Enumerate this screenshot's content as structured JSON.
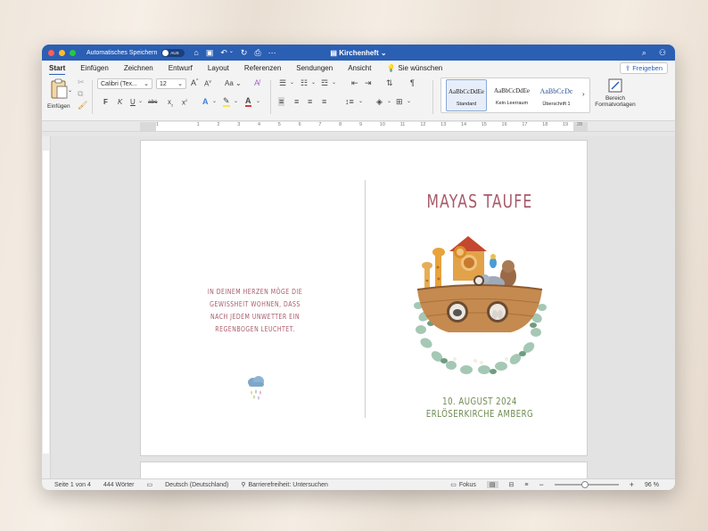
{
  "titlebar": {
    "autosave_label": "Automatisches Speichern",
    "autosave_state": "AUS",
    "document_title": "Kirchenheft"
  },
  "menu": {
    "tabs": [
      "Start",
      "Einfügen",
      "Zeichnen",
      "Entwurf",
      "Layout",
      "Referenzen",
      "Sendungen",
      "Ansicht"
    ],
    "active_tab": "Start",
    "tell_me": "Sie wünschen",
    "share": "Freigeben"
  },
  "ribbon": {
    "paste_label": "Einfügen",
    "font_name": "Calibri (Tex...",
    "font_size": "12",
    "grow_font": "A",
    "shrink_font": "A",
    "change_case": "Aa",
    "bold": "F",
    "italic": "K",
    "underline": "U",
    "strikethrough": "abc",
    "subscript": "x",
    "superscript": "x",
    "pilcrow": "¶",
    "styles": [
      {
        "preview": "AaBbCcDdEe",
        "name": "Standard"
      },
      {
        "preview": "AaBbCcDdEe",
        "name": "Kein Leerraum"
      },
      {
        "preview": "AaBbCcDc",
        "name": "Überschrift 1"
      }
    ],
    "styles_pane_label_1": "Bereich",
    "styles_pane_label_2": "Formatvorlagen"
  },
  "ruler": {
    "numbers": [
      "1",
      "",
      "1",
      "2",
      "3",
      "4",
      "5",
      "6",
      "7",
      "8",
      "9",
      "10",
      "11",
      "12",
      "13",
      "14",
      "15",
      "16",
      "17",
      "18",
      "19"
    ],
    "end_number": "28"
  },
  "document": {
    "quote": "In deinem Herzen möge die Gewissheit wohnen, dass nach jedem Unwetter ein Regenbogen leuchtet.",
    "title": "Mayas Taufe",
    "date": "10. August 2024",
    "place": "Erlöserkirche Amberg"
  },
  "status": {
    "page": "Seite 1 von 4",
    "words": "444 Wörter",
    "language": "Deutsch (Deutschland)",
    "accessibility": "Barrierefreiheit: Untersuchen",
    "focus": "Fokus",
    "zoom": "96 %",
    "zoom_level_percent": 96
  },
  "colors": {
    "titlebar": "#2b5fb4",
    "text_rose": "#a85a6a",
    "text_green": "#6f8a52"
  }
}
